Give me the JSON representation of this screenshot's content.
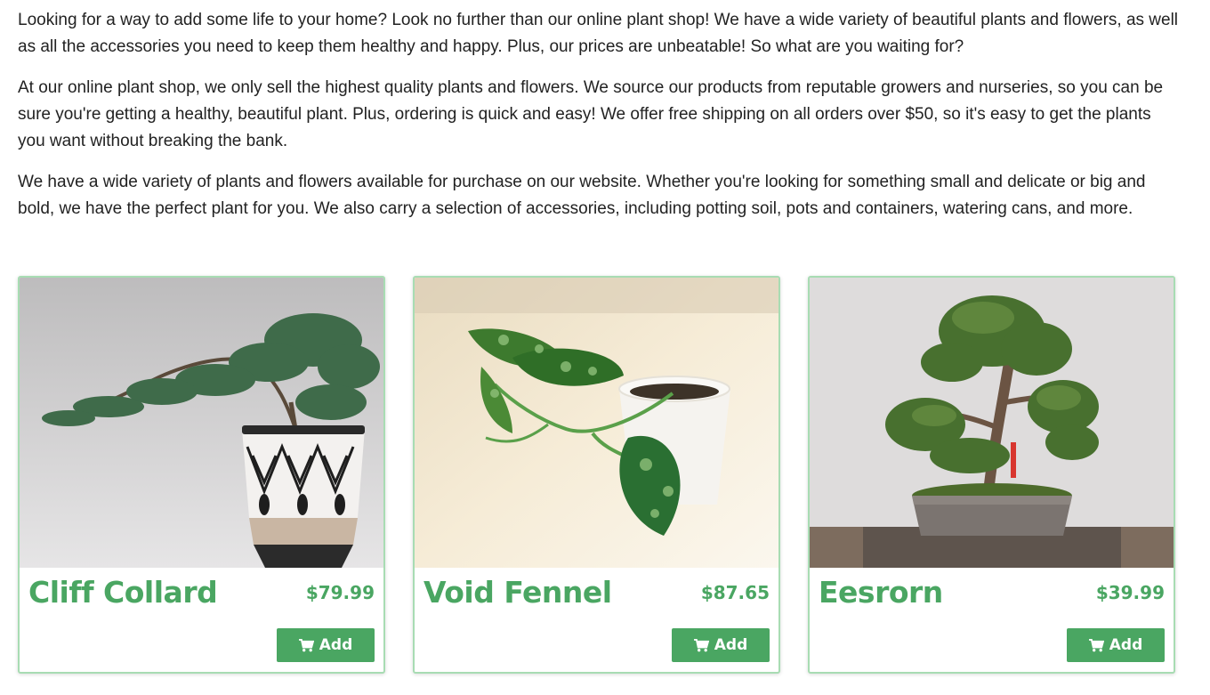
{
  "intro": {
    "paragraphs": [
      "Looking for a way to add some life to your home? Look no further than our online plant shop! We have a wide variety of beautiful plants and flowers, as well as all the accessories you need to keep them healthy and happy. Plus, our prices are unbeatable! So what are you waiting for?",
      "At our online plant shop, we only sell the highest quality plants and flowers. We source our products from reputable growers and nurseries, so you can be sure you're getting a healthy, beautiful plant. Plus, ordering is quick and easy! We offer free shipping on all orders over $50, so it's easy to get the plants you want without breaking the bank.",
      "We have a wide variety of plants and flowers available for purchase on our website. Whether you're looking for something small and delicate or big and bold, we have the perfect plant for you. We also carry a selection of accessories, including potting soil, pots and containers, watering cans, and more."
    ]
  },
  "products": [
    {
      "name": "Cliff Collard",
      "price": "$79.99",
      "add_label": "Add",
      "image_icon": "juniper-bonsai-in-patterned-pot-photo"
    },
    {
      "name": "Void Fennel",
      "price": "$87.65",
      "add_label": "Add",
      "image_icon": "pothos-cutting-in-white-pot-photo"
    },
    {
      "name": "Eesrorn",
      "price": "$39.99",
      "add_label": "Add",
      "image_icon": "bonsai-tree-in-tray-photo"
    }
  ],
  "colors": {
    "accent": "#4aa662",
    "card_border": "#a8dcb3"
  }
}
